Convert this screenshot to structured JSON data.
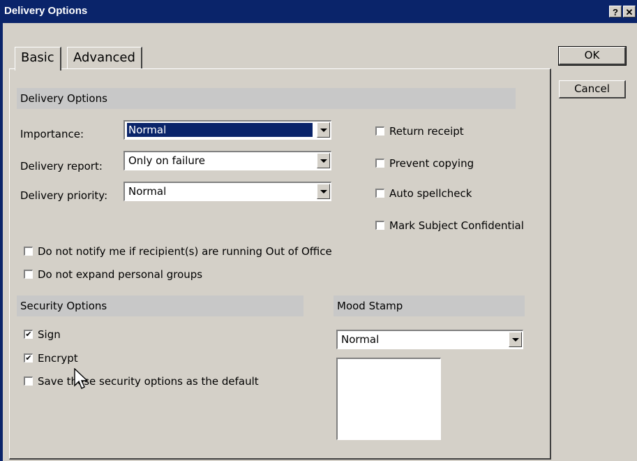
{
  "window": {
    "title": "Delivery Options",
    "help_label": "?",
    "close_label": "✕"
  },
  "tabs": [
    {
      "label": "Basic",
      "active": true
    },
    {
      "label": "Advanced",
      "active": false
    }
  ],
  "buttons": {
    "ok": "OK",
    "cancel": "Cancel"
  },
  "delivery_options": {
    "header": "Delivery Options",
    "importance_label": "Importance:",
    "importance_value": "Normal",
    "report_label": "Delivery report:",
    "report_value": "Only on failure",
    "priority_label": "Delivery priority:",
    "priority_value": "Normal",
    "return_receipt": {
      "label": "Return receipt",
      "checked": false
    },
    "prevent_copying": {
      "label": "Prevent copying",
      "checked": false
    },
    "auto_spellcheck": {
      "label": "Auto spellcheck",
      "checked": false
    },
    "mark_confidential": {
      "label": "Mark Subject Confidential",
      "checked": false
    },
    "no_notify_ooo": {
      "label": "Do not notify me if recipient(s) are running Out of Office",
      "checked": false
    },
    "no_expand_groups": {
      "label": "Do not expand personal groups",
      "checked": false
    }
  },
  "security_options": {
    "header": "Security Options",
    "sign": {
      "label": "Sign",
      "checked": true
    },
    "encrypt": {
      "label": "Encrypt",
      "checked": true
    },
    "save_default": {
      "label": "Save these security options as the default",
      "checked": false
    }
  },
  "mood_stamp": {
    "header": "Mood Stamp",
    "value": "Normal"
  },
  "check_mark": "✔",
  "colors": {
    "titlebar": "#0a246a",
    "face": "#d4d0c8",
    "group_header": "#c8c8c8",
    "selection": "#0a246a"
  }
}
